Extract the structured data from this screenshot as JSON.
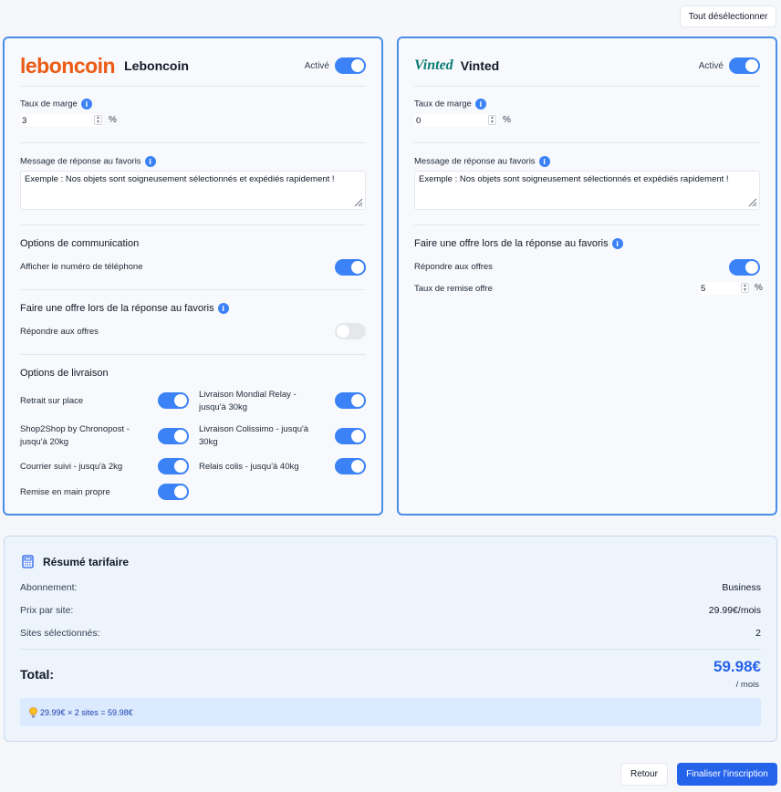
{
  "top": {
    "deselect_all": "Tout désélectionner"
  },
  "leboncoin": {
    "logo_text": "leboncoin",
    "name": "Leboncoin",
    "active_label": "Activé",
    "margin": {
      "label": "Taux de marge",
      "value": "3",
      "unit": "%"
    },
    "fav_message": {
      "label": "Message de réponse au favoris",
      "text": "Exemple : Nos objets sont soigneusement sélectionnés et expédiés rapidement !"
    },
    "communication": {
      "title": "Options de communication",
      "phone_label": "Afficher le numéro de téléphone"
    },
    "offer": {
      "title": "Faire une offre lors de la réponse au favoris",
      "respond_label": "Répondre aux offres"
    },
    "delivery": {
      "title": "Options de livraison",
      "pickup": "Retrait sur place",
      "mondial_1": "Livraison Mondial Relay -",
      "mondial_2": "jusqu'à 30kg",
      "shop2shop_1": "Shop2Shop by Chronopost -",
      "shop2shop_2": "jusqu'à 20kg",
      "colissimo_1": "Livraison Colissimo - jusqu'à",
      "colissimo_2": "30kg",
      "courrier": "Courrier suivi - jusqu'à 2kg",
      "relais": "Relais colis - jusqu'à 40kg",
      "hand": "Remise en main propre"
    },
    "toggles": {
      "active": true,
      "phone": true,
      "respond_offers": false,
      "pickup": true,
      "mondial": true,
      "shop2shop": true,
      "colissimo": true,
      "courrier": true,
      "relais": true,
      "hand": true
    }
  },
  "vinted": {
    "logo_text": "Vinted",
    "name": "Vinted",
    "active_label": "Activé",
    "margin": {
      "label": "Taux de marge",
      "value": "0",
      "unit": "%"
    },
    "fav_message": {
      "label": "Message de réponse au favoris",
      "text": "Exemple : Nos objets sont soigneusement sélectionnés et expédiés rapidement !"
    },
    "offer": {
      "title": "Faire une offre lors de la réponse au favoris",
      "respond_label": "Répondre aux offres",
      "discount_label": "Taux de remise offre",
      "discount_value": "5",
      "discount_unit": "%"
    },
    "toggles": {
      "active": true,
      "respond_offers": true
    }
  },
  "summary": {
    "title": "Résumé tarifaire",
    "rows": [
      {
        "label": "Abonnement:",
        "value": "Business"
      },
      {
        "label": "Prix par site:",
        "value": "29.99€/mois"
      },
      {
        "label": "Sites sélectionnés:",
        "value": "2"
      }
    ],
    "total_label": "Total:",
    "total_value": "59.98€",
    "total_unit": "/ mois",
    "calculation": "29.99€ × 2 sites = 59.98€"
  },
  "footer": {
    "back": "Retour",
    "finish": "Finaliser l'inscription"
  },
  "colors": {
    "accent": "#2563eb",
    "toggle_on": "#3b82f6",
    "leboncoin_brand": "#ec5a13",
    "vinted_brand": "#0d7d75"
  }
}
